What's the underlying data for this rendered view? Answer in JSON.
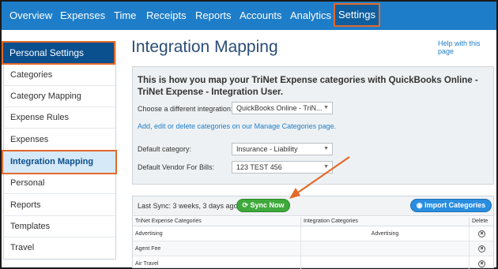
{
  "nav": {
    "items": [
      "Overview",
      "Expenses",
      "Time",
      "Receipts",
      "Reports",
      "Accounts",
      "Analytics",
      "Settings"
    ],
    "active": "Settings"
  },
  "sidebar": {
    "header": "Personal Settings",
    "items": [
      "Categories",
      "Category Mapping",
      "Expense Rules",
      "Expenses",
      "Integration Mapping",
      "Personal",
      "Reports",
      "Templates",
      "Travel"
    ],
    "active": "Integration Mapping"
  },
  "main": {
    "title": "Integration Mapping",
    "help_link": "Help with this page",
    "heading": "This is how you map your TriNet Expense categories with QuickBooks Online - TriNet Expense - Integration User.",
    "choose_label": "Choose a different integration:",
    "choose_value": "QuickBooks Online - TriN...",
    "manage_link": "Add, edit or delete categories on our Manage Categories page.",
    "default_category_label": "Default category:",
    "default_category_value": "Insurance - Liability",
    "default_vendor_label": "Default Vendor For Bills:",
    "default_vendor_value": "123 TEST 456"
  },
  "sync": {
    "last_sync": "Last Sync: 3 weeks, 3 days ago",
    "sync_button": "Sync Now",
    "import_button": "Import Categories"
  },
  "table": {
    "headers": [
      "TriNet Expense Categories",
      "Integration Categories",
      "Delete"
    ],
    "rows": [
      {
        "category": "Advertising",
        "integration": "Advertising"
      },
      {
        "category": "Agent Fee",
        "integration": ""
      },
      {
        "category": "Air Travel",
        "integration": ""
      }
    ]
  },
  "colors": {
    "nav_bg": "#1e7dc8",
    "highlight": "#e2692a",
    "sync_green": "#3faa3c",
    "import_blue": "#2a8ee0"
  },
  "icons": {
    "sync": "refresh-icon",
    "import": "globe-icon",
    "delete": "close-circle-icon",
    "dropdown": "caret-down-icon"
  }
}
